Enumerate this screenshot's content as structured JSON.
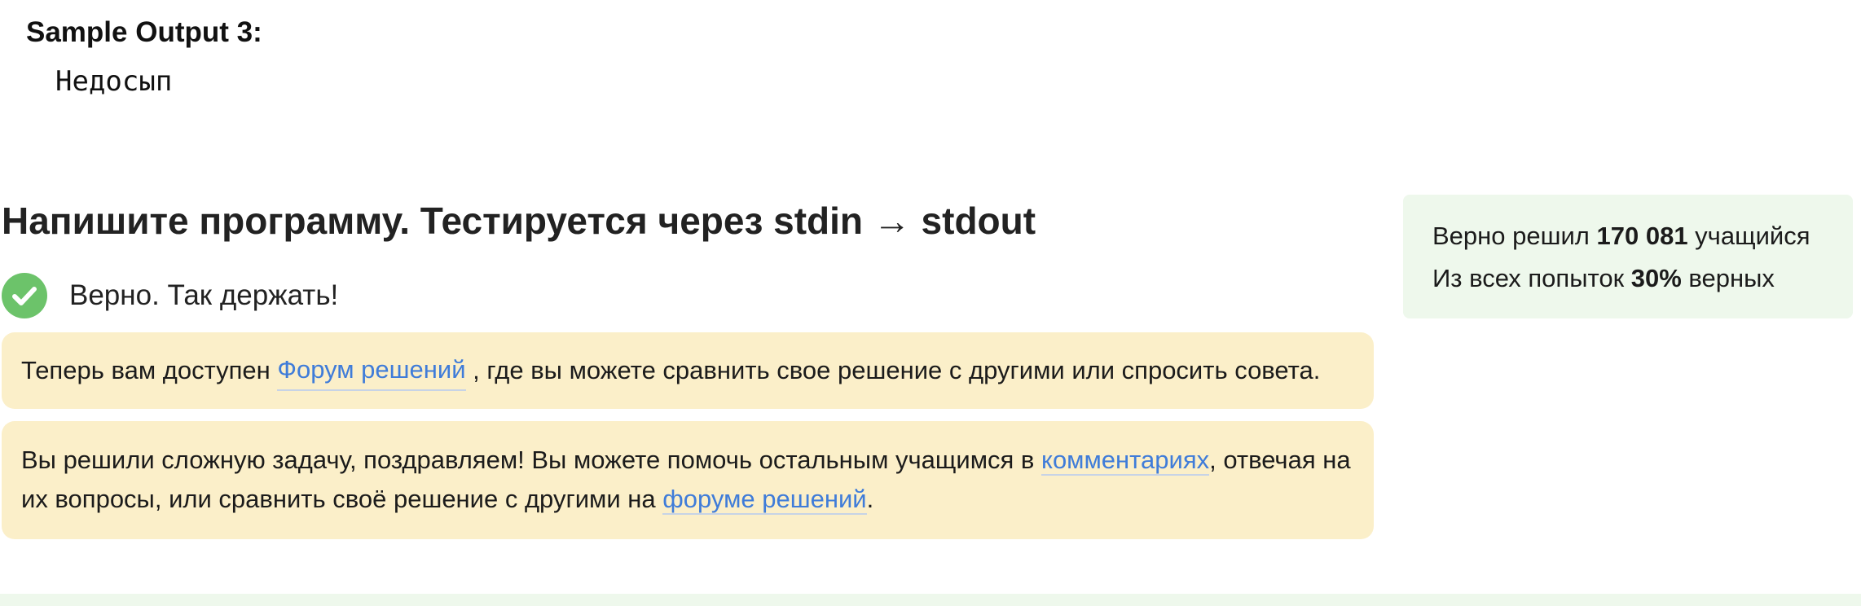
{
  "sample": {
    "title": "Sample Output 3:",
    "value": "Недосып"
  },
  "task": {
    "heading": "Напишите программу. Тестируется через stdin → stdout"
  },
  "status": {
    "icon": "check-circle-icon",
    "icon_color": "#6cc36a",
    "text": "Верно. Так держать!"
  },
  "notice_forum": {
    "before": "Теперь вам доступен ",
    "link": "Форум решений",
    "after": " , где вы можете сравнить свое решение с другими или спросить совета."
  },
  "notice_congrats": {
    "before": "Вы решили сложную задачу, поздравляем! Вы можете помочь остальным учащимся в ",
    "link_comments": "комментариях",
    "middle": ", отвечая на их вопросы, или сравнить своё решение с другими на ",
    "link_forum": "форуме решений",
    "after": "."
  },
  "stats": {
    "solved_prefix": "Верно решил ",
    "solved_count": "170 081",
    "solved_suffix": " учащийся",
    "attempts_prefix": "Из всех попыток ",
    "attempts_percent": "30%",
    "attempts_suffix": " верных"
  },
  "colors": {
    "notice_bg": "#fbefc9",
    "stats_bg": "#eef8ec",
    "link": "#3f7cd9",
    "success": "#6cc36a"
  }
}
